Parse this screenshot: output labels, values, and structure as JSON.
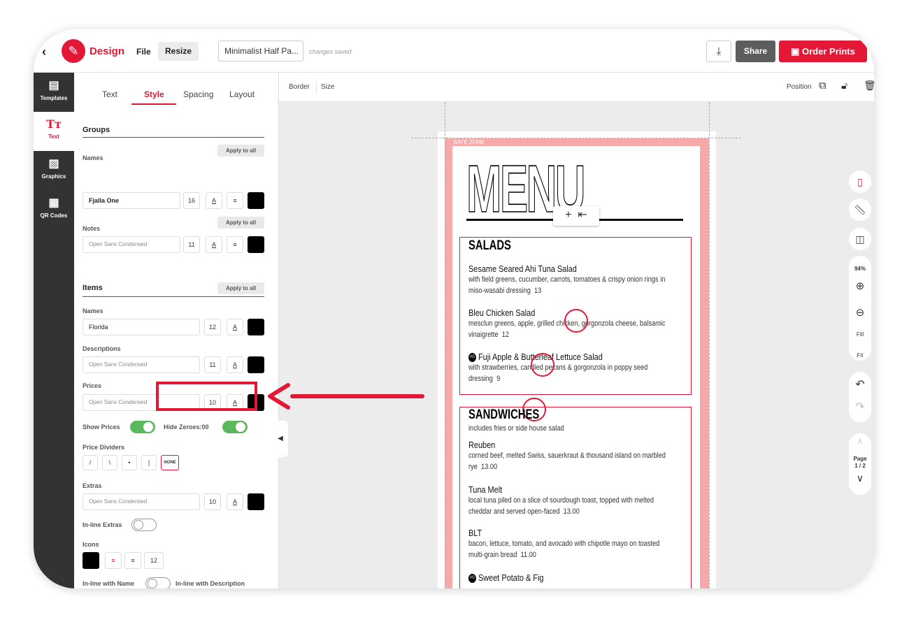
{
  "topbar": {
    "back_icon": "chevron-left-icon",
    "app_title": "Design",
    "file_label": "File",
    "resize_label": "Resize",
    "document_name": "Minimalist Half Pa...",
    "save_status": "changes saved",
    "share_label": "Share",
    "order_label": "Order Prints",
    "accent_color": "#e31837"
  },
  "rail": {
    "items": [
      {
        "label": "Templates",
        "icon": "templates-icon"
      },
      {
        "label": "Text",
        "icon": "text-icon"
      },
      {
        "label": "Graphics",
        "icon": "image-icon"
      },
      {
        "label": "QR Codes",
        "icon": "qr-code-icon"
      }
    ]
  },
  "panel": {
    "tabs": [
      "Text",
      "Style",
      "Spacing",
      "Layout"
    ],
    "active_tab": "Style",
    "apply_label": "Apply to all",
    "groups": {
      "title": "Groups",
      "names_label": "Names",
      "names_font": "Fjalla One",
      "names_size": "16",
      "notes_label": "Notes",
      "notes_font": "Open Sans Condensed",
      "notes_size": "11"
    },
    "items": {
      "title": "Items",
      "names_label": "Names",
      "names_font": "Florida",
      "names_size": "12",
      "desc_label": "Descriptions",
      "desc_font": "Open Sans Condensed",
      "desc_size": "11",
      "prices_label": "Prices",
      "prices_font": "Open Sans Condensed",
      "prices_size": "10",
      "show_prices_label": "Show Prices",
      "show_prices_on": true,
      "hide_zeroes_label": "Hide Zeroes:00",
      "hide_zeroes_on": true,
      "dividers_label": "Price Dividers",
      "dividers": [
        "/",
        "\\",
        "•",
        "|",
        "NONE"
      ],
      "extras_label": "Extras",
      "extras_font": "Open Sans Condensed",
      "extras_size": "10",
      "inline_extras_label": "In-line Extras",
      "inline_extras_on": false,
      "icons_label": "Icons",
      "icons_size": "12",
      "inline_name_label": "In-line with Name",
      "inline_desc_label": "In-line with Description",
      "inline_name_on": false
    },
    "underline_glyph": "A",
    "align_glyph": "≡"
  },
  "subbar": {
    "border_label": "Border",
    "size_label": "Size",
    "position_label": "Position"
  },
  "canvas": {
    "safe_zone_label": "SAFE ZONE",
    "menu_title": "MENU",
    "sections": [
      {
        "title": "SALADS",
        "note": "",
        "items": [
          {
            "name": "Sesame Seared Ahi Tuna Salad",
            "desc": "with field greens, cucumber, carrots, tomatoes & crispy onion rings in miso-wasabi dressing",
            "price": "13",
            "vg": false
          },
          {
            "name": "Bleu Chicken Salad",
            "desc": "mesclun greens, apple, grilled chicken, gorgonzola cheese, balsamic vinaigrette",
            "price": "12",
            "vg": false
          },
          {
            "name": "Fuji Apple & Butterleaf Lettuce Salad",
            "desc": "with strawberries, candied pecans & gorgonzola in poppy seed dressing",
            "price": "9",
            "vg": true
          }
        ]
      },
      {
        "title": "SANDWICHES",
        "note": "includes fries or side house salad",
        "items": [
          {
            "name": "Reuben",
            "desc": "corned beef, melted Swiss, sauerkraut & thousand island on marbled rye",
            "price": "13.00",
            "vg": false
          },
          {
            "name": "Tuna Melt",
            "desc": "local tuna piled on a slice of sourdough toast, topped with melted cheddar and served open-faced",
            "price": "13.00",
            "vg": false
          },
          {
            "name": "BLT",
            "desc": "bacon, lettuce, tomato, and avocado with chipotle mayo on toasted multi-grain bread",
            "price": "11.00",
            "vg": false
          },
          {
            "name": "Sweet Potato & Fig",
            "desc": "",
            "price": "",
            "vg": true
          }
        ]
      }
    ],
    "vg_badge": "VG"
  },
  "right_tools": {
    "zoom": "94%",
    "fill_label": "Fill",
    "fit_label": "Fit",
    "page_label": "Page",
    "page_count": "1 / 2"
  }
}
